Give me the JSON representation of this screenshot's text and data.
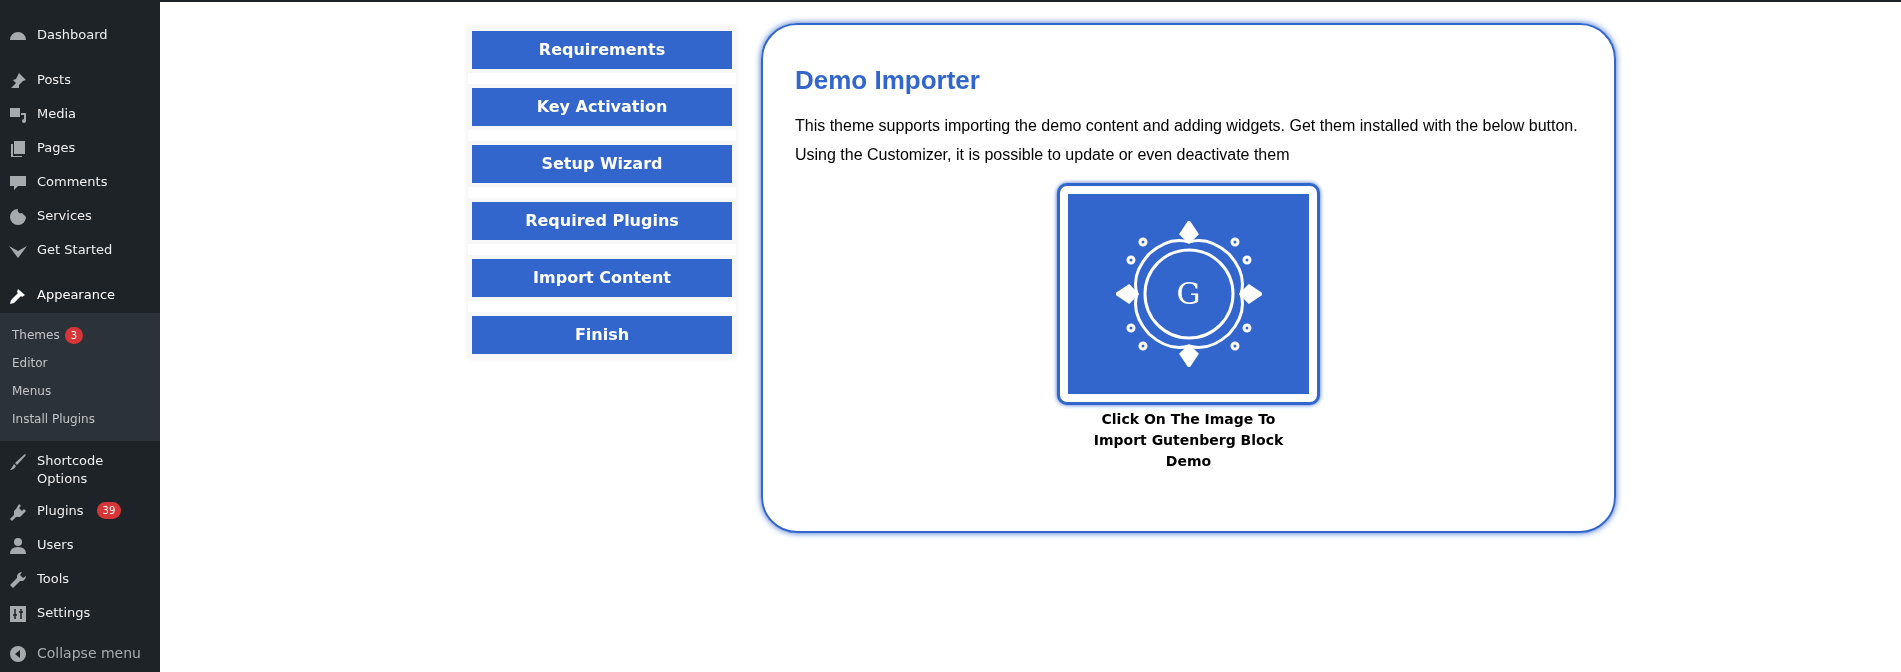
{
  "sidebar": {
    "groups": [
      [
        {
          "label": "Dashboard",
          "selected": false
        }
      ],
      [
        {
          "label": "Posts",
          "selected": false
        },
        {
          "label": "Media",
          "selected": false
        },
        {
          "label": "Pages",
          "selected": false
        },
        {
          "label": "Comments",
          "selected": false
        },
        {
          "label": "Services",
          "selected": false
        },
        {
          "label": "Get Started",
          "selected": false
        }
      ],
      [
        {
          "label": "Appearance",
          "selected": true,
          "children": [
            {
              "label": "Themes",
              "badge": "3"
            },
            {
              "label": "Editor"
            },
            {
              "label": "Menus"
            },
            {
              "label": "Install Plugins"
            }
          ]
        },
        {
          "label": "Shortcode Options",
          "selected": false
        },
        {
          "label": "Plugins",
          "selected": false,
          "badge": "39"
        },
        {
          "label": "Users",
          "selected": false
        },
        {
          "label": "Tools",
          "selected": false
        },
        {
          "label": "Settings",
          "selected": false
        }
      ]
    ],
    "collapse": "Collapse menu"
  },
  "steps": [
    "Requirements",
    "Key Activation",
    "Setup Wizard",
    "Required Plugins",
    "Import Content",
    "Finish"
  ],
  "panel": {
    "title": "Demo Importer",
    "text": "This theme supports importing the demo content and adding widgets. Get them installed with the below button. Using the Customizer, it is possible to update or even deactivate them",
    "demo": {
      "logo_letter": "G",
      "caption": "Click On The Image To Import Gutenberg Block Demo"
    }
  }
}
